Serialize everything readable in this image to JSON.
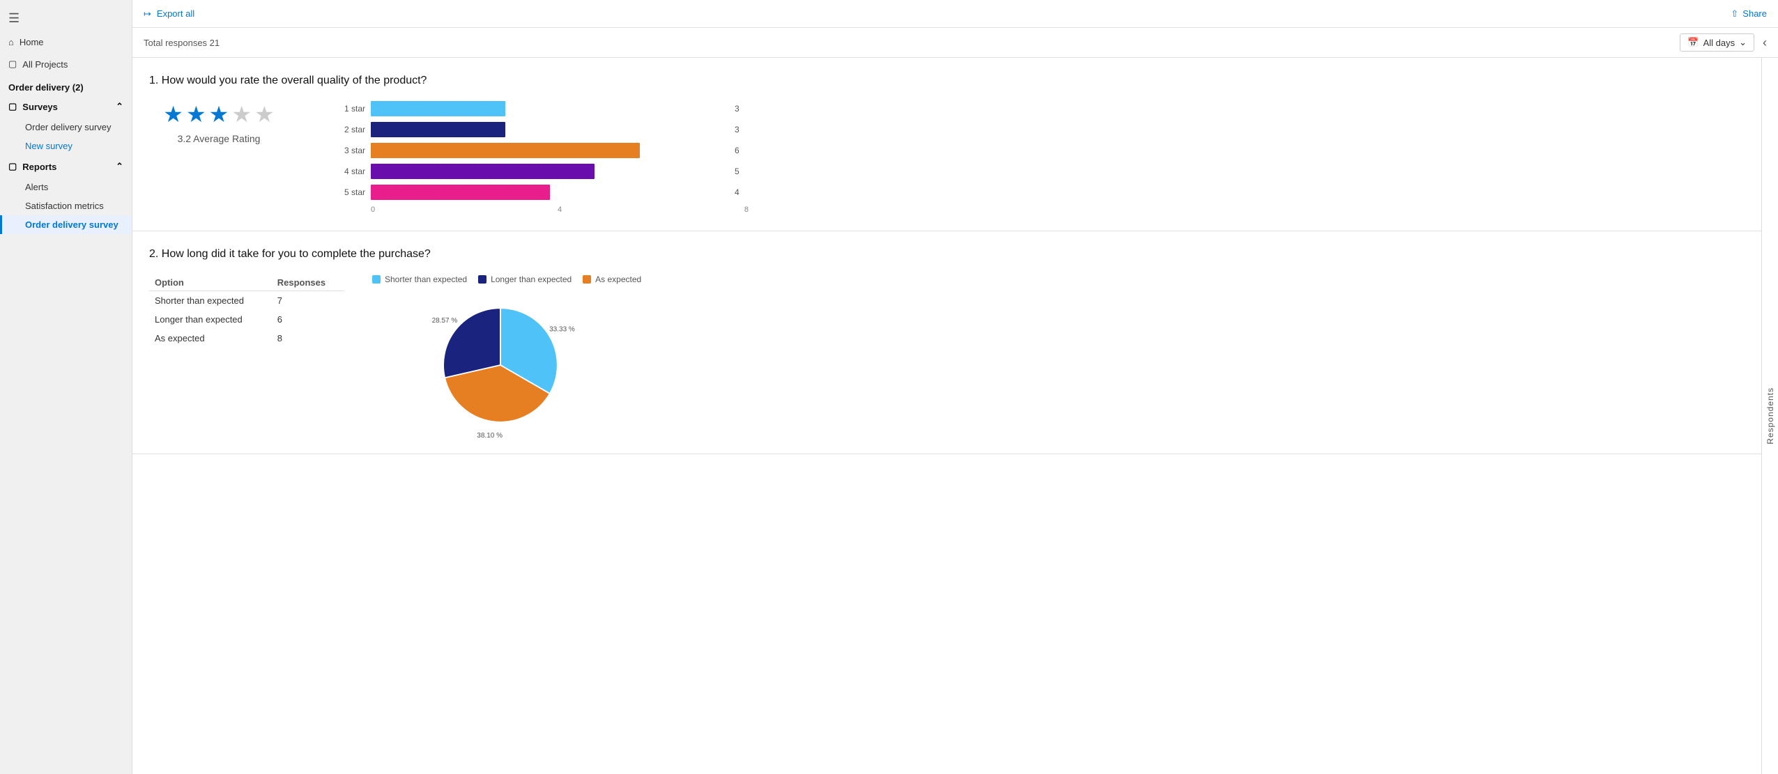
{
  "sidebar": {
    "menu_icon": "≡",
    "home_label": "Home",
    "all_projects_label": "All Projects",
    "order_delivery_label": "Order delivery (2)",
    "surveys_label": "Surveys",
    "surveys_items": [
      {
        "label": "Order delivery survey",
        "active": false
      },
      {
        "label": "New survey",
        "active": false,
        "is_new": true
      }
    ],
    "reports_label": "Reports",
    "reports_items": [
      {
        "label": "Alerts",
        "active": false
      },
      {
        "label": "Satisfaction metrics",
        "active": false
      },
      {
        "label": "Order delivery survey",
        "active": true
      }
    ]
  },
  "topbar": {
    "export_label": "Export all",
    "share_label": "Share"
  },
  "subbar": {
    "total_responses_label": "Total responses 21",
    "all_days_label": "All days"
  },
  "question1": {
    "title": "1. How would you rate the overall quality of the product?",
    "avg_rating": "3.2 Average Rating",
    "stars_filled": 3,
    "stars_empty": 2,
    "bars": [
      {
        "label": "1 star",
        "value": 3,
        "max": 8,
        "color": "#4fc3f7"
      },
      {
        "label": "2 star",
        "value": 3,
        "max": 8,
        "color": "#1a237e"
      },
      {
        "label": "3 star",
        "value": 6,
        "max": 8,
        "color": "#e67e22"
      },
      {
        "label": "4 star",
        "value": 5,
        "max": 8,
        "color": "#6a0dad"
      },
      {
        "label": "5 star",
        "value": 4,
        "max": 8,
        "color": "#e91e8c"
      }
    ],
    "axis_labels": [
      "0",
      "4",
      "8"
    ]
  },
  "question2": {
    "title": "2. How long did it take for you to complete the purchase?",
    "legend": [
      {
        "label": "Shorter than expected",
        "color": "#4fc3f7"
      },
      {
        "label": "Longer than expected",
        "color": "#1a237e"
      },
      {
        "label": "As expected",
        "color": "#e67e22"
      }
    ],
    "table_headers": [
      "Option",
      "Responses"
    ],
    "table_rows": [
      {
        "option": "Shorter than expected",
        "responses": "7"
      },
      {
        "option": "Longer than expected",
        "responses": "6"
      },
      {
        "option": "As expected",
        "responses": "8"
      }
    ],
    "pie_percentages": {
      "shorter": "33.33 %",
      "longer": "28.57 %",
      "as_expected": "38.10 %"
    }
  },
  "respondents_label": "Respondents"
}
